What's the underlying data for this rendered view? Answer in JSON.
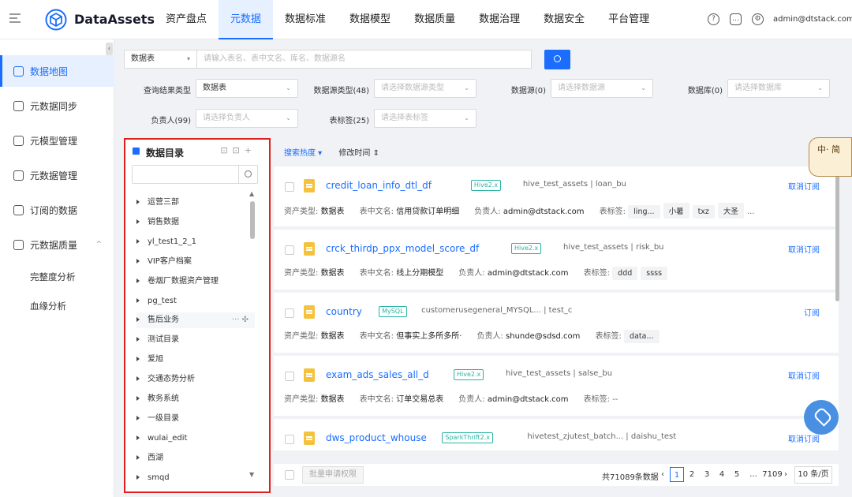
{
  "header": {
    "brand": "DataAssets",
    "nav": [
      "资产盘点",
      "元数据",
      "数据标准",
      "数据模型",
      "数据质量",
      "数据治理",
      "数据安全",
      "平台管理"
    ],
    "active_nav": "元数据",
    "user": "admin@dtstack.com",
    "icons": [
      "help-icon",
      "message-icon",
      "settings-icon"
    ]
  },
  "sidebar": {
    "collapse": "‹",
    "items": [
      {
        "label": "数据地图",
        "icon": "map-icon",
        "active": true
      },
      {
        "label": "元数据同步",
        "icon": "sync-icon"
      },
      {
        "label": "元模型管理",
        "icon": "cube-icon"
      },
      {
        "label": "元数据管理",
        "icon": "database-icon"
      },
      {
        "label": "订阅的数据",
        "icon": "subscribe-icon"
      },
      {
        "label": "元数据质量",
        "icon": "quality-icon",
        "expanded": true
      },
      {
        "label": "完整度分析",
        "sub": true
      },
      {
        "label": "血缘分析",
        "sub": true
      }
    ],
    "chevron": "^"
  },
  "search": {
    "type_value": "数据表",
    "placeholder": "请输入表名、表中文名、库名、数据源名"
  },
  "filters": [
    {
      "label": "查询结果类型",
      "value": "数据表",
      "placeholder": false
    },
    {
      "label": "数据源类型(48)",
      "value": "请选择数据源类型",
      "placeholder": true
    },
    {
      "label": "数据源(0)",
      "value": "请选择数据源",
      "placeholder": true
    },
    {
      "label": "数据库(0)",
      "value": "请选择数据库",
      "placeholder": true
    },
    {
      "label": "负责人(99)",
      "value": "请选择负责人",
      "placeholder": true
    },
    {
      "label": "表标签(25)",
      "value": "请选择表标签",
      "placeholder": true
    }
  ],
  "tree": {
    "title": "数据目录",
    "tools": "⊡⊡+",
    "items": [
      "运营三部",
      "销售数据",
      "yl_test1_2_1",
      "VIP客户档案",
      "卷烟厂数据资产管理",
      "pg_test",
      "售后业务",
      "测试目录",
      "爱旭",
      "交通态势分析",
      "教务系统",
      "一级目录",
      "wulai_edit",
      "西湖",
      "smqd"
    ],
    "hover_actions": "··· ✣"
  },
  "sorts": {
    "hot": "搜索热度 ▾",
    "time": "修改时间 ⇕"
  },
  "results": [
    {
      "name": "credit_loan_info_dtl_df",
      "tag": "Hive2.x",
      "source": "hive_test_assets | loan_bu",
      "action": "取消订阅",
      "type": "数据表",
      "cn": "信用贷款订单明细",
      "owner": "admin@dtstack.com",
      "tags": [
        "ling...",
        "小暑",
        "txz",
        "大圣"
      ],
      "more": "..."
    },
    {
      "name": "crck_thirdp_ppx_model_score_df",
      "tag": "Hive2.x",
      "source": "hive_test_assets | risk_bu",
      "action": "取消订阅",
      "type": "数据表",
      "cn": "线上分期模型",
      "owner": "admin@dtstack.com",
      "tags": [
        "ddd",
        "ssss"
      ],
      "more": ""
    },
    {
      "name": "country",
      "tag": "MySQL",
      "source": "customerusegeneral_MYSQL... | test_c",
      "action": "订阅",
      "type": "数据表",
      "cn": "但事实上多所多所·",
      "owner": "shunde@sdsd.com",
      "tags": [
        "data..."
      ],
      "more": ""
    },
    {
      "name": "exam_ads_sales_all_d",
      "tag": "Hive2.x",
      "source": "hive_test_assets | salse_bu",
      "action": "取消订阅",
      "type": "数据表",
      "cn": "订单交易总表",
      "owner": "admin@dtstack.com",
      "tags": [],
      "more": "--"
    },
    {
      "name": "dws_product_whouse",
      "tag": "SparkThrift2.x",
      "source": "hivetest_zjutest_batch... | daishu_test",
      "action": "取消订阅",
      "type": "数据表",
      "cn": "",
      "owner": "",
      "tags": [],
      "more": ""
    }
  ],
  "meta_labels": {
    "type": "资产类型:",
    "cn": "表中文名:",
    "owner": "负责人:",
    "tags": "表标签:"
  },
  "pager": {
    "batch": "批量申请权限",
    "total": "共71089条数据",
    "pages": [
      "1",
      "2",
      "3",
      "4",
      "5",
      "...",
      "7109"
    ],
    "prev": "‹",
    "next": "›",
    "size": "10 条/页"
  },
  "mascot": "中·\n 简"
}
